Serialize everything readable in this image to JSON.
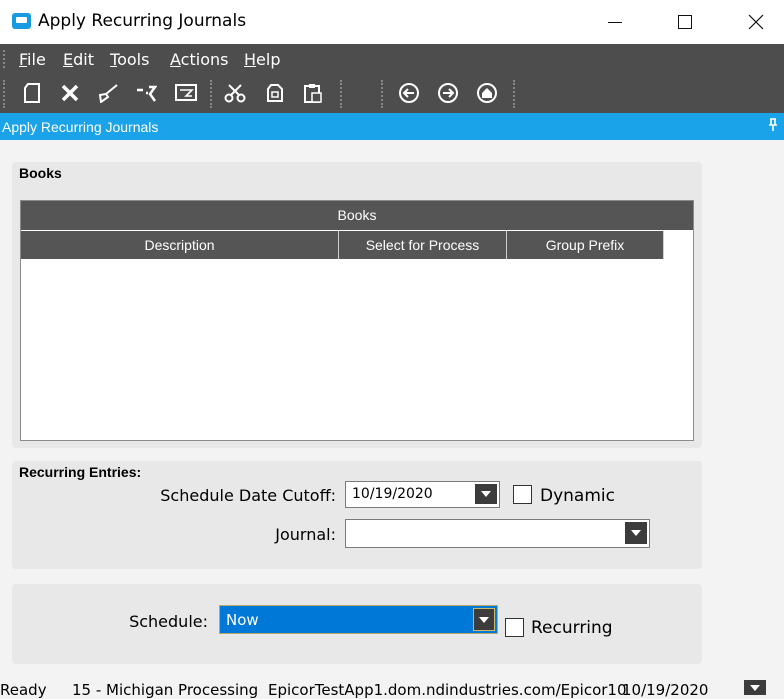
{
  "window": {
    "title": "Apply Recurring Journals",
    "controls": [
      "minimize",
      "maximize",
      "close"
    ]
  },
  "menu": {
    "items": [
      {
        "label": "File",
        "accel": "F",
        "rest": "ile"
      },
      {
        "label": "Edit",
        "accel": "E",
        "rest": "dit"
      },
      {
        "label": "Tools",
        "accel": "T",
        "rest": "ools"
      },
      {
        "label": "Actions",
        "accel": "A",
        "rest": "ctions"
      },
      {
        "label": "Help",
        "accel": "H",
        "rest": "elp"
      }
    ]
  },
  "toolbar": {
    "buttons": [
      "new-icon",
      "delete-icon",
      "clear-icon",
      "refresh-icon",
      "print-preview-icon",
      "cut-icon",
      "copy-icon",
      "paste-icon",
      "back-icon",
      "forward-icon",
      "home-icon"
    ]
  },
  "panel": {
    "title": "Apply Recurring Journals"
  },
  "books": {
    "group_label": "Books",
    "grid_caption": "Books",
    "columns": [
      "Description",
      "Select for Process",
      "Group Prefix"
    ],
    "rows": []
  },
  "recurring": {
    "group_label": "Recurring Entries:",
    "cutoff_label": "Schedule Date Cutoff:",
    "cutoff_value": "10/19/2020",
    "dynamic_label": "Dynamic",
    "dynamic_checked": false,
    "journal_label": "Journal:",
    "journal_value": ""
  },
  "schedule": {
    "label": "Schedule:",
    "value": "Now",
    "recurring_label": "Recurring",
    "recurring_checked": false
  },
  "status": {
    "state": "Ready",
    "company": "15 - Michigan Processing",
    "server": "EpicorTestApp1.dom.ndindustries.com/Epicor10",
    "date": "10/19/2020"
  },
  "colors": {
    "accent": "#1aa3e8",
    "toolbar": "#4d4d4d",
    "grid_header": "#555555",
    "selection": "#0078d7"
  }
}
